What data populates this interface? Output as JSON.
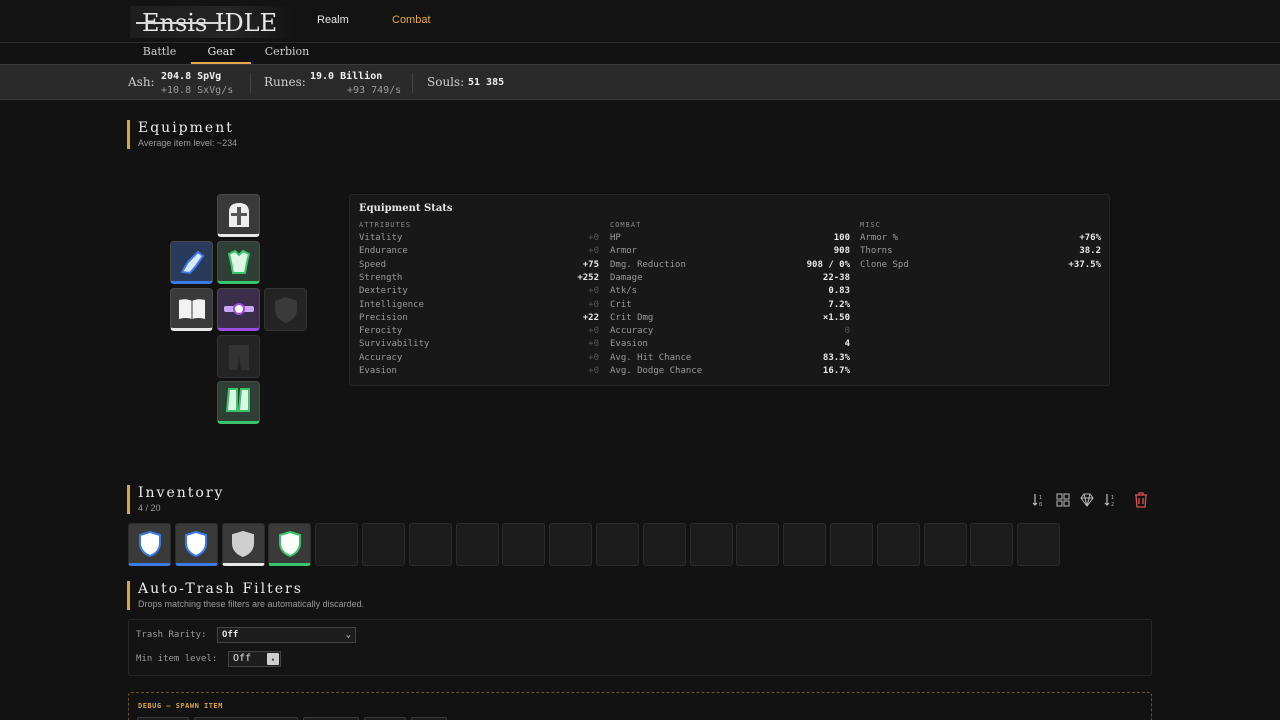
{
  "app": {
    "logo_text": "Ensis IDLE"
  },
  "nav": {
    "realm": "Realm",
    "combat": "Combat"
  },
  "tabs": {
    "battle": "Battle",
    "gear": "Gear",
    "cerbion": "Cerbion"
  },
  "resources": {
    "ash": {
      "label": "Ash:",
      "value": "204.8 SpVg",
      "rate": "+10.8 SxVg/s"
    },
    "runes": {
      "label": "Runes:",
      "value": "19.0 Billion",
      "rate": "+93 749/s"
    },
    "souls": {
      "label": "Souls:",
      "value": "51 385"
    }
  },
  "equipment": {
    "title": "Equipment",
    "subtitle": "Average item level: ~234",
    "slots": [
      {
        "name": "helmet",
        "rarity": "white",
        "icon": "helmet-icon"
      },
      {
        "name": "gloves",
        "rarity": "blue",
        "icon": "gauntlet-icon"
      },
      {
        "name": "chest",
        "rarity": "green",
        "icon": "chest-armor-icon"
      },
      {
        "name": "tome",
        "rarity": "white",
        "icon": "book-icon"
      },
      {
        "name": "belt",
        "rarity": "purple",
        "icon": "belt-icon"
      },
      {
        "name": "offhand",
        "rarity": "empty",
        "icon": "shield-icon"
      },
      {
        "name": "legs",
        "rarity": "empty",
        "icon": "pants-icon"
      },
      {
        "name": "boots",
        "rarity": "green",
        "icon": "boots-icon"
      }
    ]
  },
  "stats": {
    "title": "Equipment Stats",
    "attributes_head": "ATTRIBUTES",
    "combat_head": "COMBAT",
    "misc_head": "MISC",
    "attributes": [
      {
        "k": "Vitality",
        "v": "+0"
      },
      {
        "k": "Endurance",
        "v": "+0"
      },
      {
        "k": "Speed",
        "v": "+75"
      },
      {
        "k": "Strength",
        "v": "+252"
      },
      {
        "k": "Dexterity",
        "v": "+0"
      },
      {
        "k": "Intelligence",
        "v": "+0"
      },
      {
        "k": "Precision",
        "v": "+22"
      },
      {
        "k": "Ferocity",
        "v": "+0"
      },
      {
        "k": "Survivability",
        "v": "+0"
      },
      {
        "k": "Accuracy",
        "v": "+0"
      },
      {
        "k": "Evasion",
        "v": "+0"
      }
    ],
    "combat": [
      {
        "k": "HP",
        "v": "100"
      },
      {
        "k": "Armor",
        "v": "908"
      },
      {
        "k": "Dmg. Reduction",
        "v": "908 / 0%"
      },
      {
        "k": "Damage",
        "v": "22-38"
      },
      {
        "k": "Atk/s",
        "v": "0.83"
      },
      {
        "k": "Crit",
        "v": "7.2%"
      },
      {
        "k": "Crit Dmg",
        "v": "×1.50"
      },
      {
        "k": "Accuracy",
        "v": "0"
      },
      {
        "k": "Evasion",
        "v": "4"
      },
      {
        "k": "Avg. Hit Chance",
        "v": "83.3%"
      },
      {
        "k": "Avg. Dodge Chance",
        "v": "16.7%"
      }
    ],
    "misc": [
      {
        "k": "Armor %",
        "v": "+76%"
      },
      {
        "k": "Thorns",
        "v": "38.2"
      },
      {
        "k": "Clone Spd",
        "v": "+37.5%"
      }
    ]
  },
  "inventory": {
    "title": "Inventory",
    "count": "4 / 20",
    "items": [
      "blue",
      "blue",
      "white",
      "green",
      "",
      "",
      "",
      "",
      "",
      "",
      "",
      "",
      "",
      "",
      "",
      "",
      "",
      "",
      "",
      ""
    ]
  },
  "autotrash": {
    "title": "Auto-Trash Filters",
    "subtitle": "Drops matching these filters are automatically discarded.",
    "rarity_label": "Trash Rarity:",
    "rarity_value": "Off",
    "minlvl_label": "Min item level:",
    "minlvl_value": "Off"
  },
  "debug": {
    "title": "DEBUG — SPAWN ITEM"
  },
  "colors": {
    "accent": "#d9a441",
    "blue": "#3b7be8",
    "green": "#39c46a",
    "purple": "#9b4be6"
  }
}
